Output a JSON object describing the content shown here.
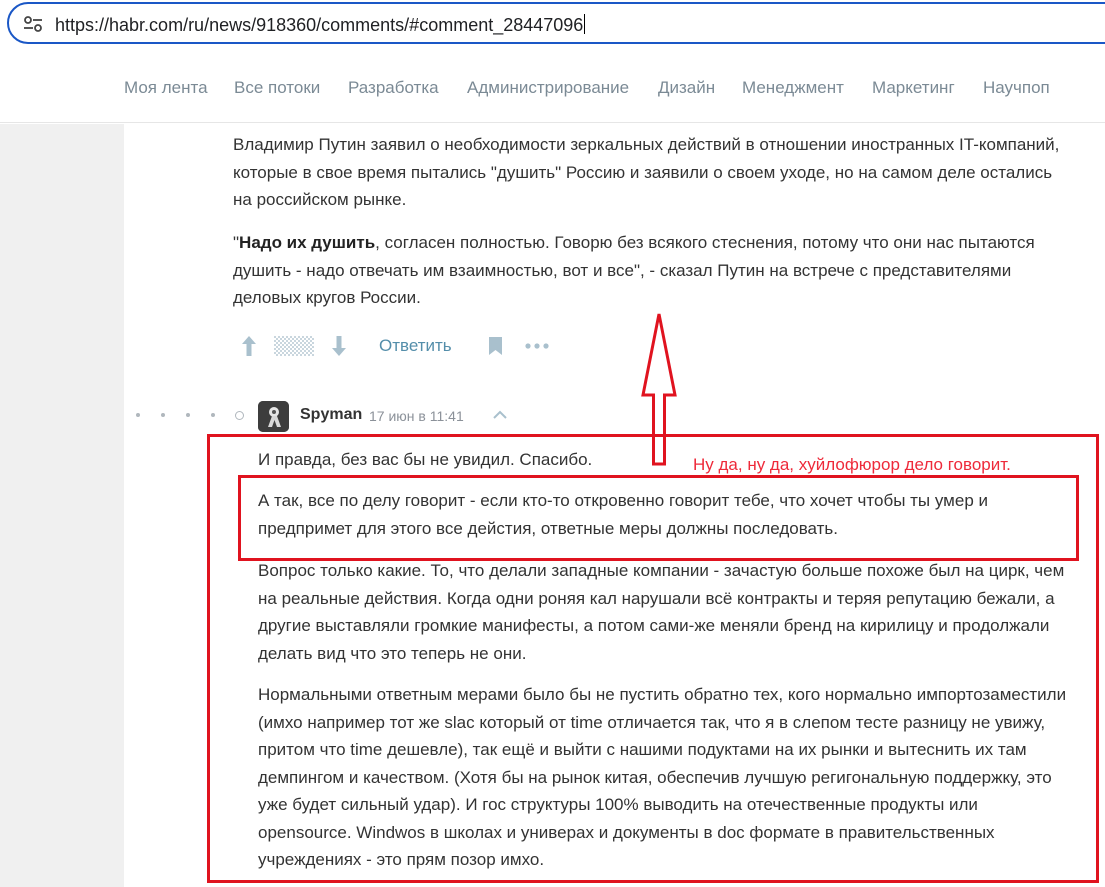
{
  "browser": {
    "url": "https://habr.com/ru/news/918360/comments/#comment_28447096",
    "site_settings_icon": "tune-icon"
  },
  "nav": {
    "items": [
      "Моя лента",
      "Все потоки",
      "Разработка",
      "Администрирование",
      "Дизайн",
      "Менеджмент",
      "Маркетинг",
      "Научпоп"
    ]
  },
  "parent_comment": {
    "paragraph1": "Владимир Путин заявил о необходимости зеркальных действий в отношении иностранных IT-компаний, которые в свое время пытались \"душить\" Россию и заявили о своем уходе, но на самом деле остались на российском рынке.",
    "paragraph2_bold": "Надо их душить",
    "paragraph2_rest": ", согласен полностью. Говорю без всякого стеснения, потому что они нас пытаются душить - надо отвечать им взаимностью, вот и все\", - сказал Путин на встрече с представителями деловых кругов России.",
    "actions": {
      "upvote_icon": "arrow-up-icon",
      "rating_icon": "hidden-rating-icon",
      "downvote_icon": "arrow-down-icon",
      "reply_label": "Ответить",
      "bookmark_icon": "bookmark-icon",
      "more_icon": "more-icon"
    }
  },
  "reply_comment": {
    "author": "Spyman",
    "timestamp": "17 июн в 11:41",
    "paragraphs": [
      "И правда, без вас бы не увидил. Спасибо.",
      "А так, все по делу говорит - если кто-то откровенно говорит тебе, что хочет чтобы ты умер и предпримет для этого все дейстия, ответные меры должны последовать.",
      "Вопрос только какие. То, что делали западные компании - зачастую больше похоже был на цирк, чем на реальные действия. Когда одни роняя кал нарушали всё контракты и теряя репутацию бежали, а другие выставляли громкие манифесты, а потом сами-же меняли бренд на кирилицу и продолжали делать вид что это теперь не они.",
      "Нормальными ответным мерами было бы не пустить обратно тех, кого нормально импортозаместили (имхо например тот же slac который от time отличается так, что я в слепом тесте разницу не увижу, притом что time дешевле), так ещё и выйти с нашими подуктами на их рынки и вытеснить их там демпингом и качеством. (Хотя бы на рынок китая, обеспечив лучшую регигональную поддержку, это уже будет сильный удар). И гос структуры 100% выводить на отечественные продукты или opensource. Windwos в школах и универах и документы в doc формате в правительственных учреждениях - это прям позор имхо."
    ]
  },
  "annotation": {
    "note": "Ну да, ну да, хуйлофюрор дело говорит.",
    "color": "#e0131f"
  },
  "colors": {
    "link": "#548eaa",
    "nav_text": "#7b8a95",
    "url_focus_border": "#1a57c6"
  }
}
